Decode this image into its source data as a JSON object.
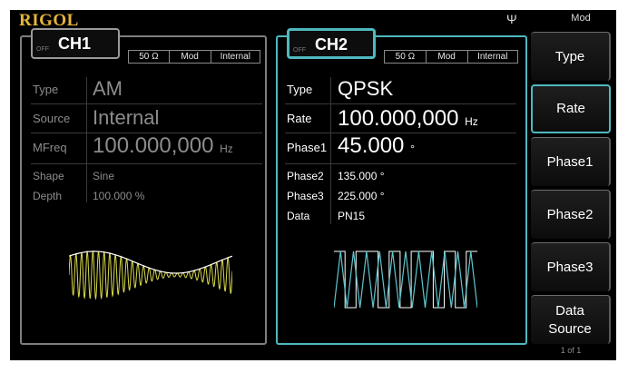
{
  "header": {
    "brand": "RIGOL",
    "usb_symbol": "Ψ",
    "menu_title": "Mod"
  },
  "ch1": {
    "name": "CH1",
    "state": "OFF",
    "info": [
      "50 Ω",
      "Mod",
      "Internal"
    ],
    "params": {
      "type_label": "Type",
      "type_value": "AM",
      "source_label": "Source",
      "source_value": "Internal",
      "mfreq_label": "MFreq",
      "mfreq_value": "100.000,000",
      "mfreq_unit": "Hz",
      "shape_label": "Shape",
      "shape_value": "Sine",
      "depth_label": "Depth",
      "depth_value": "100.000 %"
    },
    "waveform": {
      "name": "am-waveform",
      "carrier_color": "#d9d94a",
      "envelope_color": "#ffffff"
    }
  },
  "ch2": {
    "name": "CH2",
    "state": "OFF",
    "info": [
      "50 Ω",
      "Mod",
      "Internal"
    ],
    "params": {
      "type_label": "Type",
      "type_value": "QPSK",
      "rate_label": "Rate",
      "rate_value": "100.000,000",
      "rate_unit": "Hz",
      "phase1_label": "Phase1",
      "phase1_value": "45.000",
      "phase1_unit": "°",
      "phase2_label": "Phase2",
      "phase2_value": "135.000 °",
      "phase3_label": "Phase3",
      "phase3_value": "225.000 °",
      "data_label": "Data",
      "data_value": "PN15"
    },
    "waveform": {
      "name": "qpsk-waveform",
      "carrier_color": "#5fc4cc",
      "data_color": "#ffffff"
    }
  },
  "softkeys": [
    "Type",
    "Rate",
    "Phase1",
    "Phase2",
    "Phase3",
    "Data Source"
  ],
  "softkey_selected": "Rate",
  "page_indicator": "1 of 1",
  "colors": {
    "accent": "#4fb8bf",
    "brand": "#e7b53a",
    "ch1_wave": "#d9d94a"
  }
}
